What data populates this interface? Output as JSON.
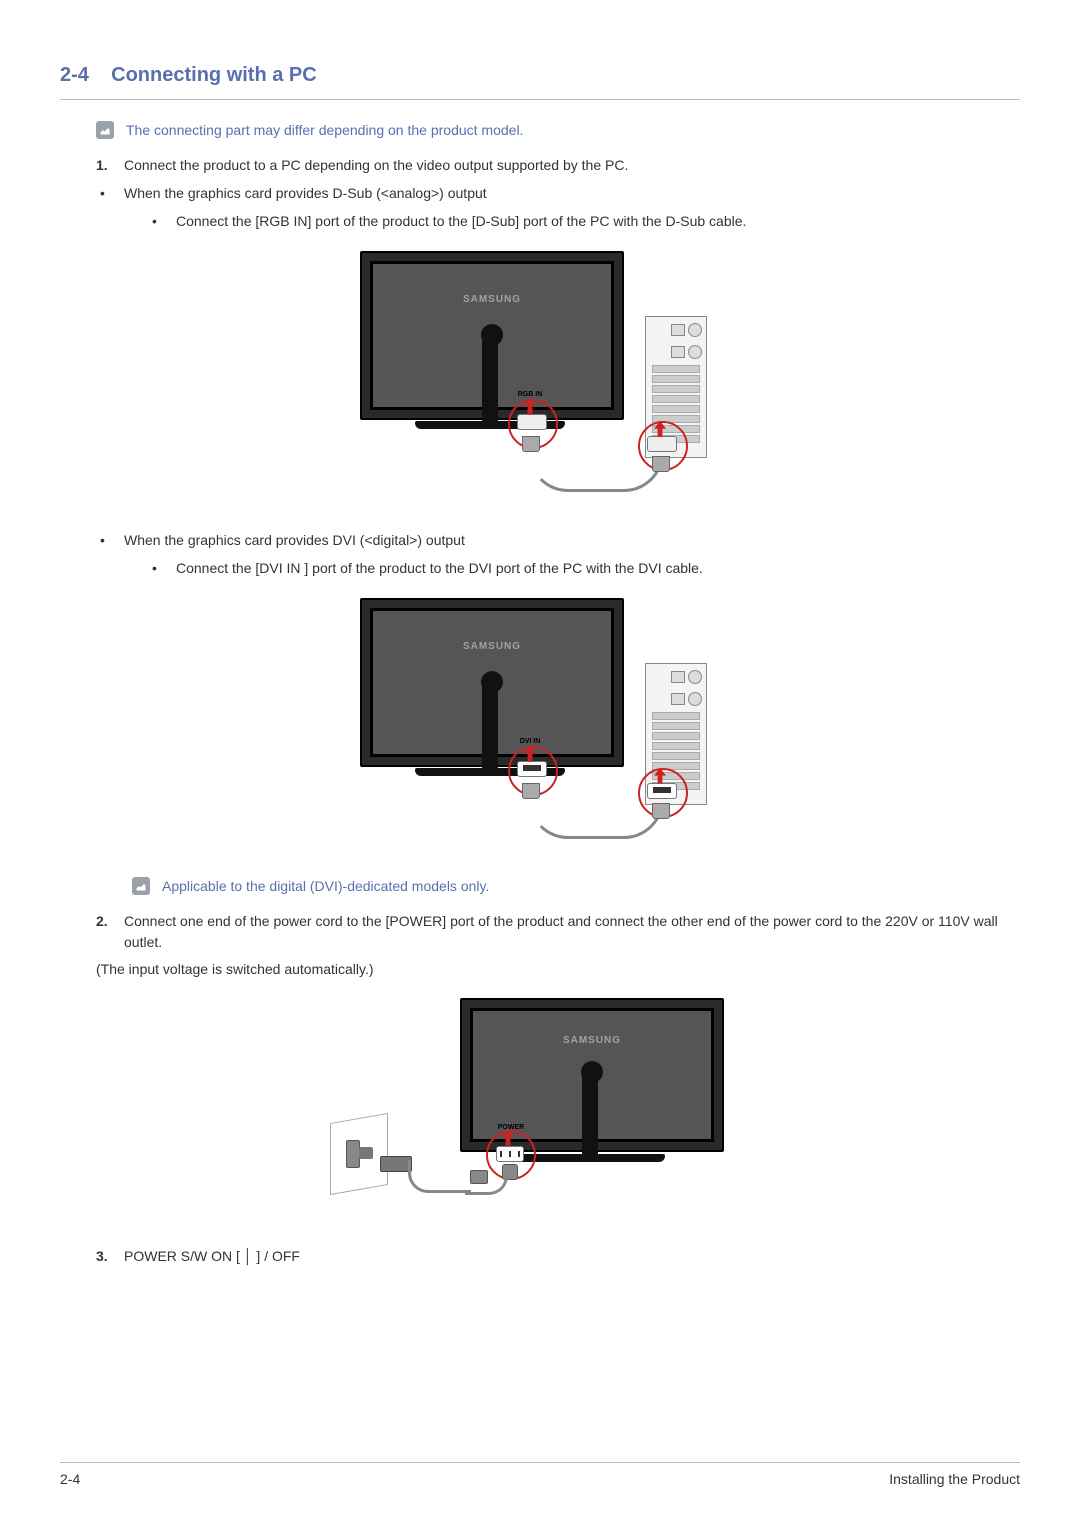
{
  "heading": {
    "number": "2-4",
    "title": "Connecting with a PC"
  },
  "note1": "The connecting part may differ depending on the product model.",
  "step1": "Connect the product to a PC depending on the video output supported by the PC.",
  "dsub_intro": "When the graphics card provides D-Sub (<analog>) output",
  "dsub_detail": "Connect the [RGB IN] port of the product to the [D-Sub] port of the PC with the D-Sub cable.",
  "dvi_intro": "When the graphics card provides DVI (<digital>) output",
  "dvi_detail": "Connect the [DVI IN ] port of the product to the DVI port of the PC with the DVI cable.",
  "note2": "Applicable to the digital (DVI)-dedicated models only.",
  "step2": "Connect one end of the power cord to the [POWER] port of the product and connect the other end of the power cord to the 220V or 110V wall outlet.",
  "auto_voltage": "(The input voltage is switched automatically.)",
  "step3": "POWER S/W ON [ │ ] / OFF",
  "labels": {
    "brand": "SAMSUNG",
    "rgb_in": "RGB IN",
    "dvi_in": "DVI IN",
    "power": "POWER"
  },
  "footer": {
    "left": "2-4",
    "right": "Installing the Product"
  }
}
